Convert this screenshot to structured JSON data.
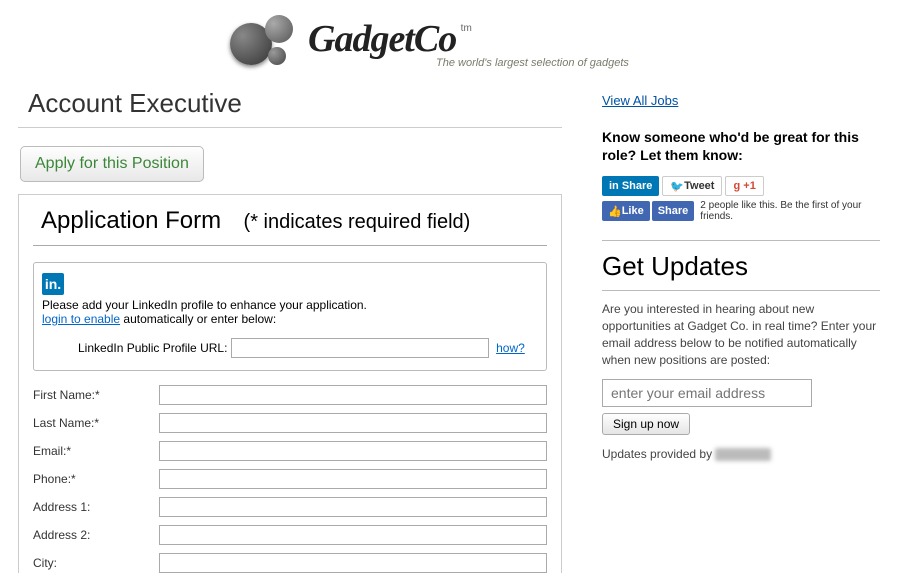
{
  "brand": {
    "name": "GadgetCo",
    "tm": "tm",
    "tagline": "The world's largest selection of gadgets"
  },
  "job": {
    "title": "Account Executive",
    "apply_label": "Apply for this Position"
  },
  "form": {
    "heading": "Application Form",
    "required_note": "(* indicates required field)",
    "linkedin": {
      "instruction": "Please add your LinkedIn profile to enhance your application.",
      "login_link": "login to enable",
      "login_trail": " automatically or enter below:",
      "url_label": "LinkedIn Public Profile URL:",
      "how_label": "how?",
      "icon_text": "in."
    },
    "fields": {
      "first_name": "First Name:*",
      "last_name": "Last Name:*",
      "email": "Email:*",
      "phone": "Phone:*",
      "address1": "Address 1:",
      "address2": "Address 2:",
      "city": "City:"
    }
  },
  "sidebar": {
    "view_all": "View All Jobs",
    "know_someone": "Know someone who'd be great for this role? Let them know:",
    "share": {
      "linkedin": "in Share",
      "twitter": "Tweet",
      "gplus": "+1"
    },
    "fb": {
      "like": "Like",
      "share": "Share",
      "caption": "2 people like this. Be the first of your friends."
    },
    "updates": {
      "title": "Get Updates",
      "text": "Are you interested in hearing about new opportunities at Gadget Co. in real time? Enter your email address below to be notified automatically when new positions are posted:",
      "email_placeholder": "enter your email address",
      "signup_label": "Sign up now",
      "provided_prefix": "Updates provided by "
    }
  }
}
